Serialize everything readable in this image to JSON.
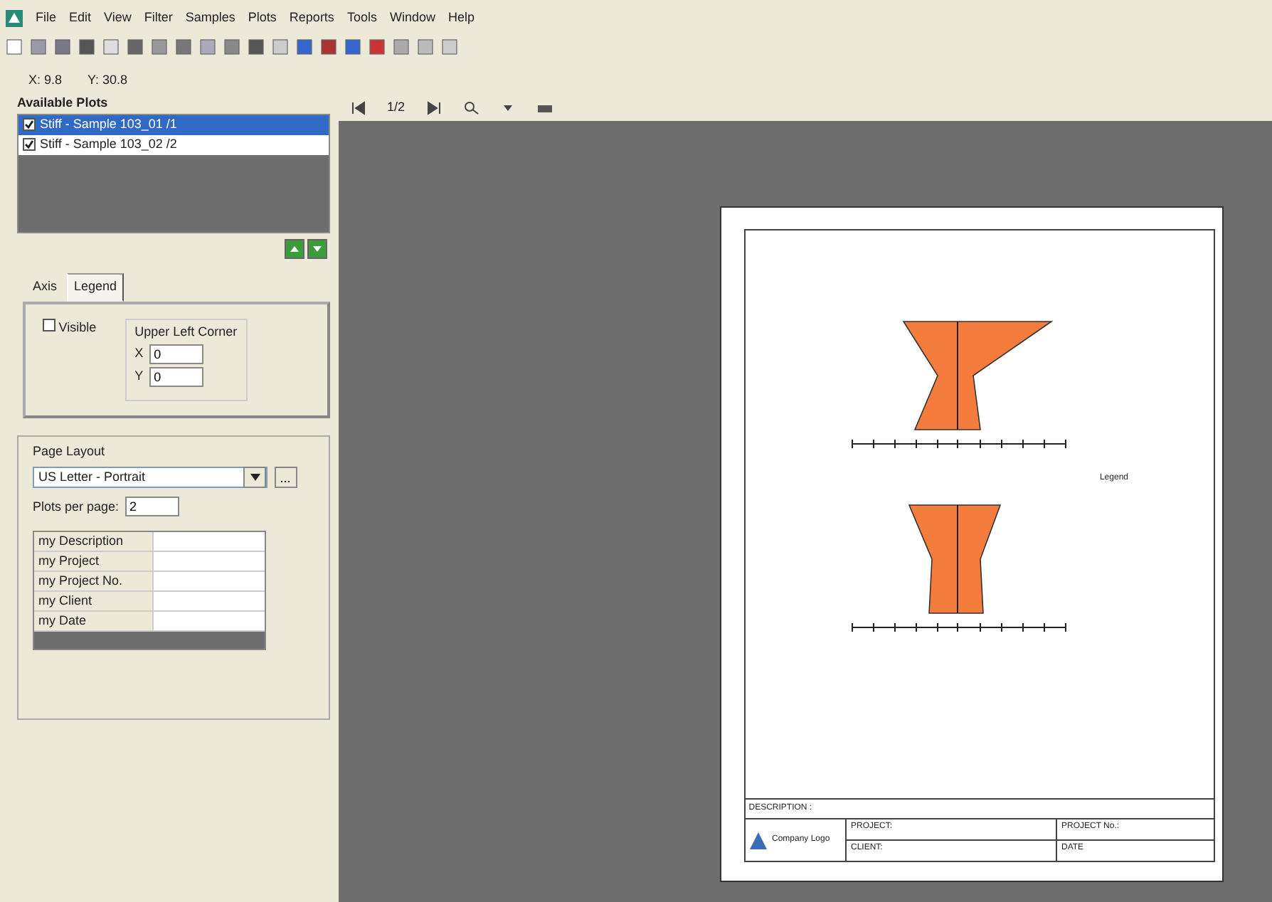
{
  "menu": [
    "File",
    "Edit",
    "View",
    "Filter",
    "Samples",
    "Plots",
    "Reports",
    "Tools",
    "Window",
    "Help"
  ],
  "coords": {
    "x": "X: 9.8",
    "y": "Y: 30.8"
  },
  "available_plots": {
    "title": "Available Plots",
    "items": [
      {
        "label": "Stiff - Sample 103_01 /1",
        "checked": true,
        "selected": true
      },
      {
        "label": "Stiff - Sample 103_02 /2",
        "checked": true,
        "selected": false
      }
    ]
  },
  "tabs": [
    {
      "label": "Axis",
      "selected": false
    },
    {
      "label": "Legend",
      "selected": true
    }
  ],
  "legend": {
    "visible_label": "Visible",
    "visible": false,
    "group_title": "Upper Left Corner",
    "x_label": "X",
    "x_value": "0",
    "y_label": "Y",
    "y_value": "0"
  },
  "page_layout": {
    "title": "Page Layout",
    "layout": "US Letter - Portrait",
    "more": "...",
    "plots_per_page_label": "Plots per page:",
    "plots_per_page": "2",
    "fields": [
      "my Description",
      "my Project",
      "my Project No.",
      "my Client",
      "my Date"
    ]
  },
  "pager": {
    "page": "1/2"
  },
  "sheet": {
    "legend_label": "Legend",
    "description": "DESCRIPTION :",
    "logo": "Company Logo",
    "project": "PROJECT:",
    "project_no": "PROJECT No.:",
    "client": "CLIENT:",
    "date": "DATE"
  }
}
